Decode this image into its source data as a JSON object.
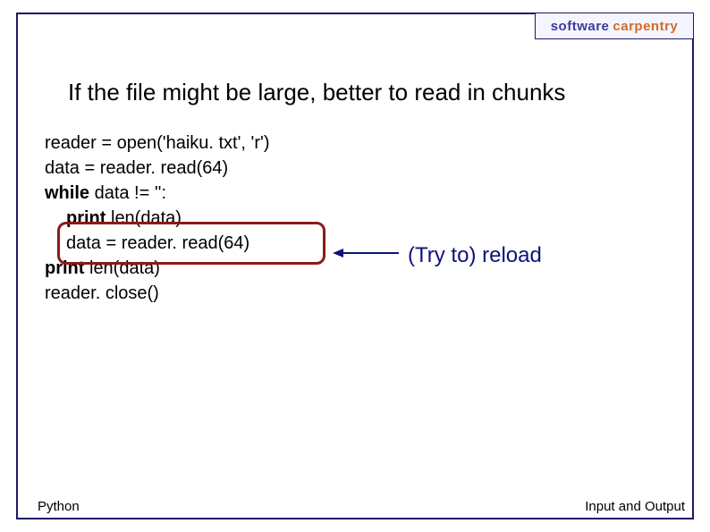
{
  "logo": {
    "left": "software",
    "right": "carpentry"
  },
  "title": "If the file might be large, better to read in chunks",
  "code": {
    "l1a": "reader = open('haiku. txt', 'r')",
    "l2a": "data = reader. read(64)",
    "l3_kw": "while",
    "l3_rest": " data != '':",
    "l4_kw": "print",
    "l4_rest": " len(data)",
    "l5a": "data = reader. read(64)",
    "l6_kw": "print",
    "l6_rest": " len(data)",
    "l7a": "reader. close()"
  },
  "annotation": "(Try to) reload",
  "footer": {
    "left": "Python",
    "right": "Input and Output"
  }
}
